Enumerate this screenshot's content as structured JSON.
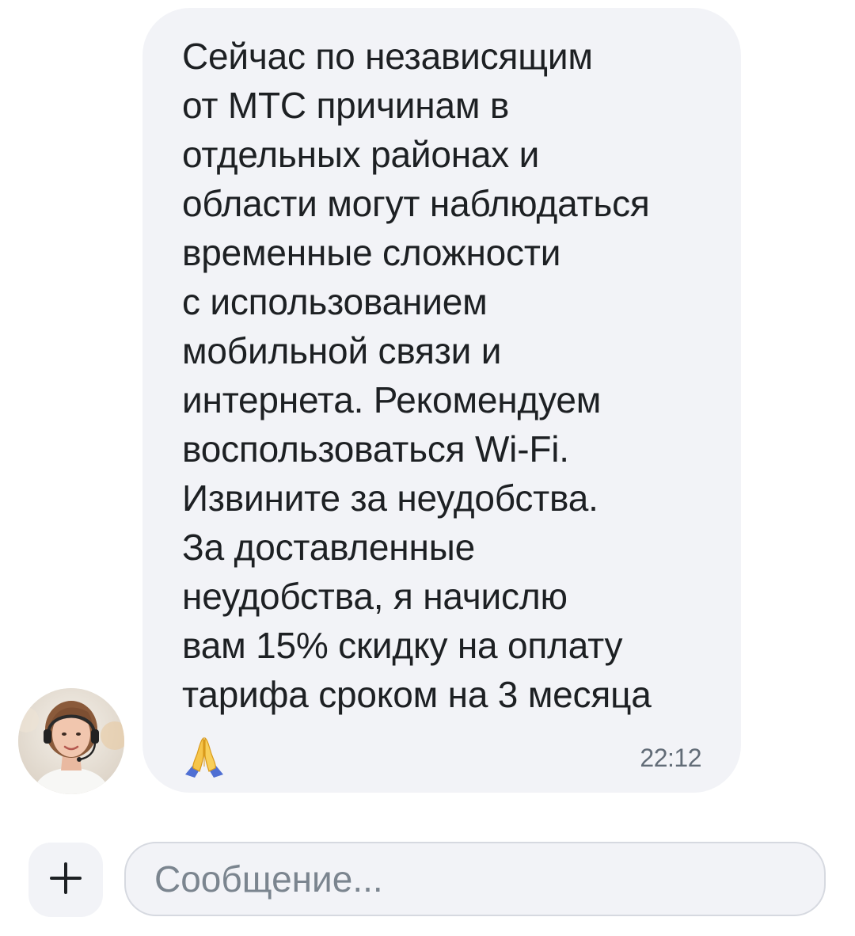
{
  "message": {
    "text": "Сейчас по независящим\nот МТС причинам в\nотдельных районах и\nобласти могут наблюдаться\nвременные сложности\nс использованием\nмобильной связи и\nинтернета. Рекомендуем\nвоспользоваться Wi-Fi.\nИзвините за неудобства.\nЗа доставленные\nнеудобства, я начислю\nвам 15% скидку на оплату\nтарифа сроком на 3 месяца",
    "emoji": "folded-hands-icon",
    "time": "22:12"
  },
  "avatar": {
    "icon": "operator-avatar"
  },
  "composer": {
    "add_icon": "plus-icon",
    "placeholder": "Сообщение...",
    "value": ""
  },
  "colors": {
    "bubble": "#f2f3f7",
    "text": "#1d2023",
    "time": "#626c77",
    "placeholder": "#7b858f"
  }
}
